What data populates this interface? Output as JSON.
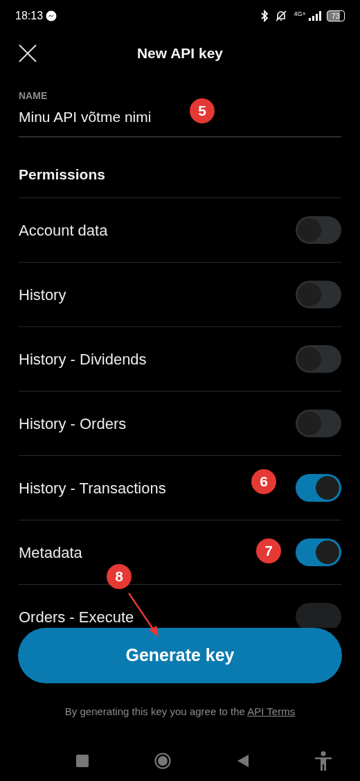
{
  "status_bar": {
    "time": "18:13",
    "network": "4G+",
    "battery": "73"
  },
  "header": {
    "title": "New API key"
  },
  "name_field": {
    "label": "NAME",
    "value": "Minu API võtme nimi"
  },
  "permissions": {
    "title": "Permissions",
    "items": [
      {
        "label": "Account data",
        "on": false
      },
      {
        "label": "History",
        "on": false
      },
      {
        "label": "History - Dividends",
        "on": false
      },
      {
        "label": "History - Orders",
        "on": false
      },
      {
        "label": "History - Transactions",
        "on": true
      },
      {
        "label": "Metadata",
        "on": true
      },
      {
        "label": "Orders - Execute",
        "on": false
      }
    ]
  },
  "generate_button": {
    "label": "Generate key"
  },
  "terms": {
    "text": "By generating this key you agree to the",
    "link": "API Terms"
  },
  "annotations": [
    {
      "label": "5",
      "arrow": false
    },
    {
      "label": "6",
      "arrow": false
    },
    {
      "label": "7",
      "arrow": false
    },
    {
      "label": "8",
      "arrow": true
    }
  ]
}
